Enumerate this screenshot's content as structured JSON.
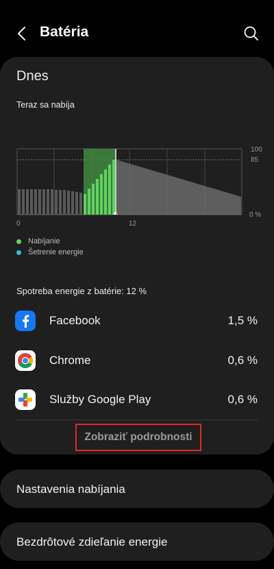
{
  "header": {
    "title": "Batéria",
    "back_icon": "chevron-left-icon",
    "search_icon": "search-icon"
  },
  "today": {
    "title": "Dnes",
    "status": "Teraz sa nabíja",
    "chart": {
      "y_top_label": "100",
      "y_85_label": "85",
      "y_bottom_label": "0 %",
      "x_labels": [
        "0",
        "12"
      ],
      "charging_color": "#5fd35f",
      "discharging_color": "#5a5a5a",
      "projection_color": "#6e6e6e"
    },
    "legend": [
      {
        "label": "Nabíjanie",
        "color": "#5fd35f"
      },
      {
        "label": "Šetrenie energie",
        "color": "#27c7d8"
      }
    ]
  },
  "usage": {
    "title": "Spotreba energie z batérie: 12 %",
    "apps": [
      {
        "name": "Facebook",
        "percent": "1,5 %",
        "icon": "facebook-icon"
      },
      {
        "name": "Chrome",
        "percent": "0,6 %",
        "icon": "chrome-icon"
      },
      {
        "name": "Služby Google Play",
        "percent": "0,6 %",
        "icon": "google-play-services-icon"
      }
    ],
    "details_button": "Zobraziť podrobnosti"
  },
  "settings": [
    {
      "label": "Nastavenia nabíjania"
    },
    {
      "label": "Bezdrôtové zdieľanie energie"
    }
  ]
}
